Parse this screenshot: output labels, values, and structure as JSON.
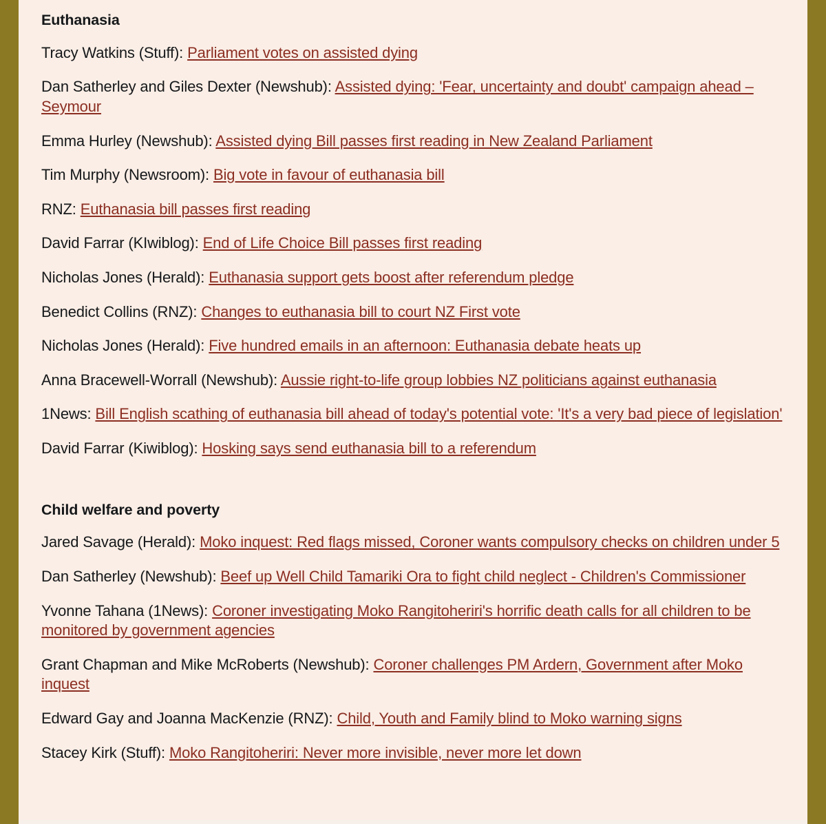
{
  "theme": {
    "page_background": "#8b7923",
    "sheet_background": "#faeee6",
    "text_color": "#16181a",
    "link_color": "#8c2e22"
  },
  "sections": [
    {
      "heading": "Euthanasia",
      "entries": [
        {
          "byline": "Tracy Watkins (Stuff): ",
          "headline": "Parliament votes on assisted dying"
        },
        {
          "byline": "Dan Satherley and Giles Dexter (Newshub): ",
          "headline": "Assisted dying: 'Fear, uncertainty and doubt' campaign ahead – Seymour"
        },
        {
          "byline": "Emma Hurley (Newshub): ",
          "headline": "Assisted dying Bill passes first reading in New Zealand Parliament"
        },
        {
          "byline": "Tim Murphy (Newsroom): ",
          "headline": "Big vote in favour of euthanasia bill"
        },
        {
          "byline": "RNZ: ",
          "headline": "Euthanasia bill passes first reading"
        },
        {
          "byline": "David Farrar (KIwiblog): ",
          "headline": "End of Life Choice Bill passes first reading"
        },
        {
          "byline": "Nicholas Jones (Herald): ",
          "headline": "Euthanasia support gets boost after referendum pledge"
        },
        {
          "byline": "Benedict Collins (RNZ): ",
          "headline": "Changes to euthanasia bill to court NZ First vote"
        },
        {
          "byline": "Nicholas Jones (Herald): ",
          "headline": "Five hundred emails in an afternoon: Euthanasia debate heats up"
        },
        {
          "byline": "Anna Bracewell-Worrall (Newshub): ",
          "headline": "Aussie right-to-life group lobbies NZ politicians against euthanasia"
        },
        {
          "byline": "1News: ",
          "headline": "Bill English scathing of euthanasia bill ahead of today's potential vote: 'It's a very bad piece of legislation'"
        },
        {
          "byline": "David Farrar (Kiwiblog): ",
          "headline": "Hosking says send euthanasia bill to a referendum"
        }
      ]
    },
    {
      "heading": "Child welfare and poverty",
      "entries": [
        {
          "byline": "Jared Savage (Herald): ",
          "headline": "Moko inquest: Red flags missed, Coroner wants compulsory checks on children under 5"
        },
        {
          "byline": "Dan Satherley (Newshub): ",
          "headline": "Beef up Well Child Tamariki Ora to fight child neglect - Children's Commissioner"
        },
        {
          "byline": "Yvonne Tahana (1News): ",
          "headline": "Coroner investigating Moko Rangitoheriri's horrific death calls for all children to be monitored by government agencies"
        },
        {
          "byline": "Grant Chapman and Mike McRoberts (Newshub): ",
          "headline": "Coroner challenges PM Ardern, Government after Moko inquest"
        },
        {
          "byline": "Edward Gay and Joanna MacKenzie (RNZ): ",
          "headline": "Child, Youth and Family blind to Moko warning signs"
        },
        {
          "byline": "Stacey Kirk (Stuff): ",
          "headline": "Moko Rangitoheriri: Never more invisible, never more let down"
        }
      ]
    }
  ]
}
